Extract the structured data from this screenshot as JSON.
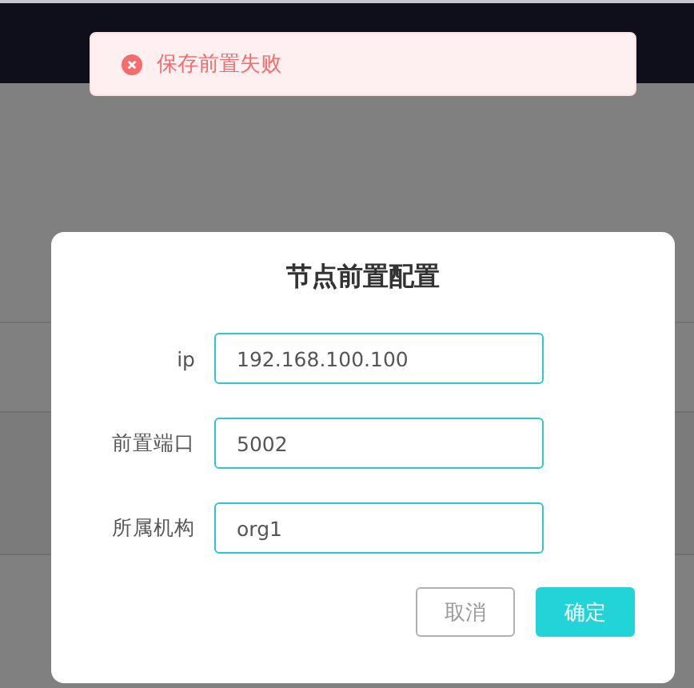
{
  "toast": {
    "kind": "error",
    "message": "保存前置失败"
  },
  "dialog": {
    "title": "节点前置配置",
    "fields": [
      {
        "label": "ip",
        "value": "192.168.100.100"
      },
      {
        "label": "前置端口",
        "value": "5002"
      },
      {
        "label": "所属机构",
        "value": "org1"
      }
    ],
    "buttons": [
      {
        "label": "取消",
        "kind": "secondary"
      },
      {
        "label": "确定",
        "kind": "primary"
      }
    ]
  }
}
